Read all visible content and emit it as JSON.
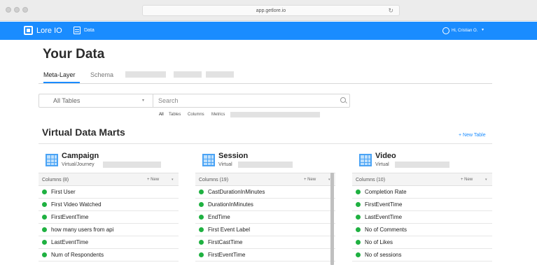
{
  "browser": {
    "url": "app.getlore.io"
  },
  "appbar": {
    "app_name": "Lore IO",
    "nav_data": "Data",
    "user_name": "Hi, Cristian O."
  },
  "page": {
    "title": "Your Data"
  },
  "tabs": [
    {
      "label": "Meta-Layer"
    },
    {
      "label": "Schema"
    }
  ],
  "filter": {
    "table_select": "All Tables",
    "search_placeholder": "Search",
    "scopes": [
      {
        "label": "All"
      },
      {
        "label": "Tables"
      },
      {
        "label": "Columns"
      },
      {
        "label": "Metrics"
      }
    ]
  },
  "section": {
    "title": "Virtual Data Marts",
    "new_table": "+ New Table"
  },
  "cards": [
    {
      "title": "Campaign",
      "subtitle": "Virtual/Journey",
      "columns_label": "Columns",
      "columns_count": "(8)",
      "new_label": "+ New",
      "columns": [
        "First User",
        "First Video Watched",
        "FirstEventTime",
        "how many users from api",
        "LastEventTime",
        "Num of Respondents"
      ]
    },
    {
      "title": "Session",
      "subtitle": "Virtual",
      "columns_label": "Columns",
      "columns_count": "(19)",
      "new_label": "+ New",
      "columns": [
        "CastDurationInMinutes",
        "DurationInMinutes",
        "EndTime",
        "First Event Label",
        "FirstCastTime",
        "FirstEventTime"
      ]
    },
    {
      "title": "Video",
      "subtitle": "Virtual",
      "columns_label": "Columns",
      "columns_count": "(10)",
      "new_label": "+ New",
      "columns": [
        "Completion Rate",
        "FirstEventTime",
        "LastEventTime",
        "No of Comments",
        "No of Likes",
        "No of sessions"
      ]
    }
  ]
}
